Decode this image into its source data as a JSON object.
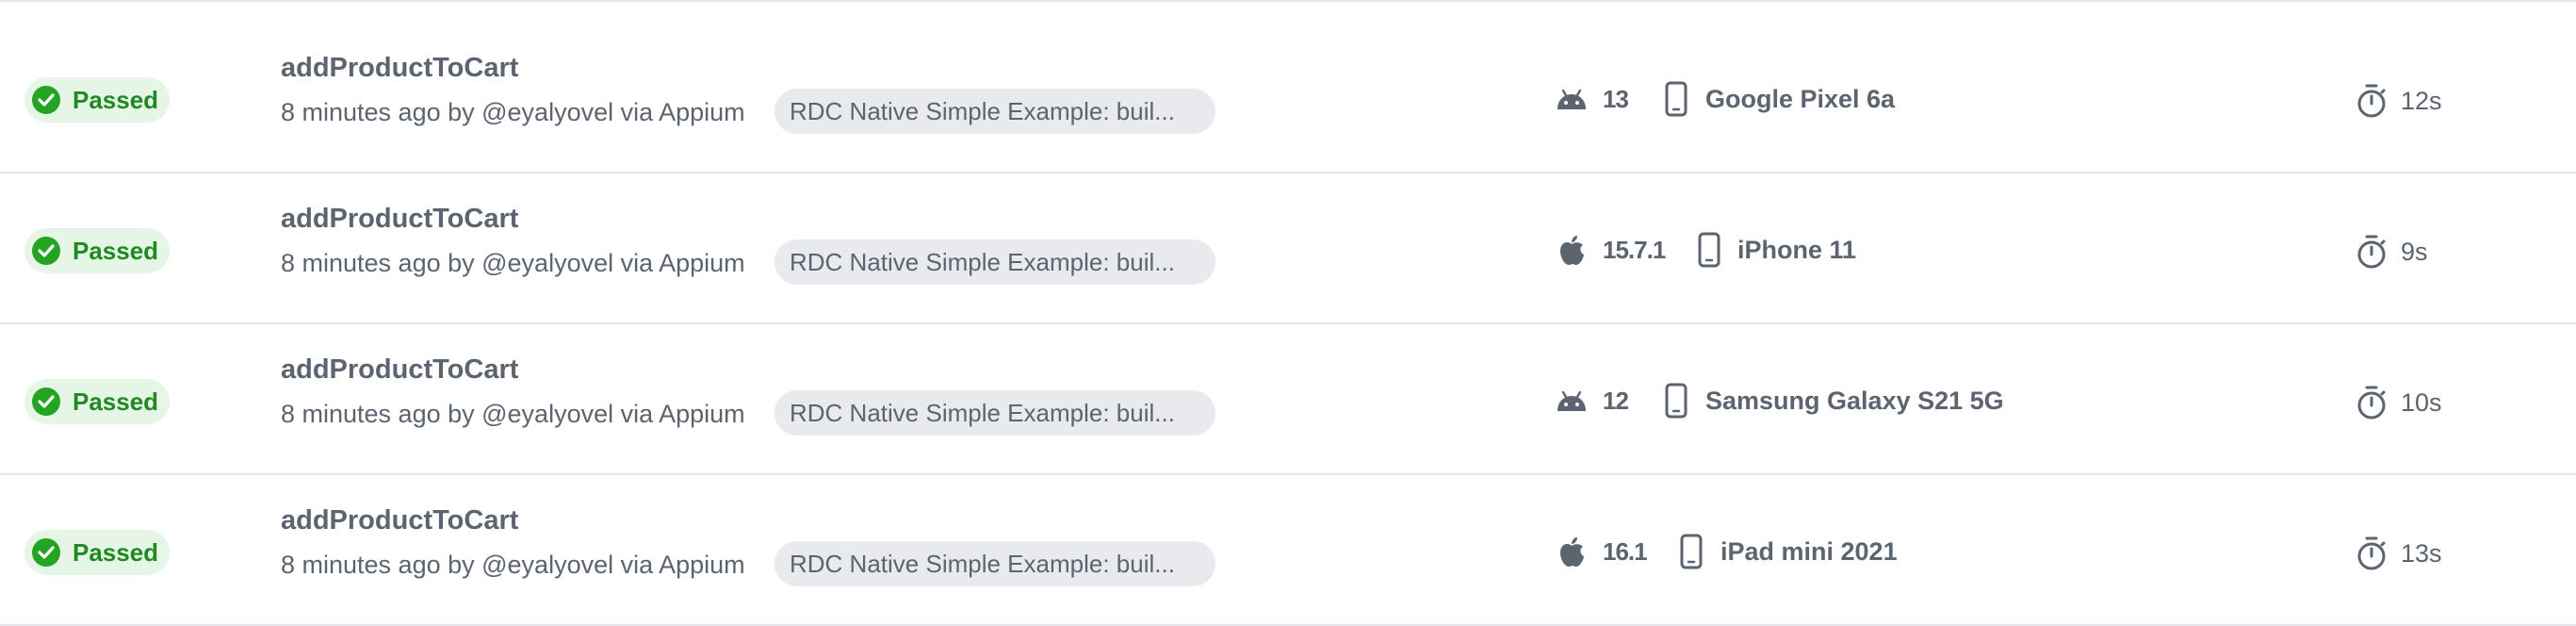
{
  "colors": {
    "passed_bg": "#e6f6e6",
    "passed_text": "#1f8a21",
    "passed_check": "#23a423",
    "chip_bg": "#e8eaee",
    "text": "#5c6470",
    "divider": "#e6e8eb"
  },
  "tests": [
    {
      "status": "Passed",
      "name": "addProductToCart",
      "meta": "8 minutes ago by @eyalyovel via Appium",
      "build": "RDC Native Simple Example: buil...",
      "os_icon": "android-icon",
      "os_version": "13",
      "device_icon": "phone-icon",
      "device": "Google Pixel 6a",
      "timer_icon": "stopwatch-icon",
      "duration": "12s"
    },
    {
      "status": "Passed",
      "name": "addProductToCart",
      "meta": "8 minutes ago by @eyalyovel via Appium",
      "build": "RDC Native Simple Example: buil...",
      "os_icon": "apple-icon",
      "os_version": "15.7.1",
      "device_icon": "phone-icon",
      "device": "iPhone 11",
      "timer_icon": "stopwatch-icon",
      "duration": "9s"
    },
    {
      "status": "Passed",
      "name": "addProductToCart",
      "meta": "8 minutes ago by @eyalyovel via Appium",
      "build": "RDC Native Simple Example: buil...",
      "os_icon": "android-icon",
      "os_version": "12",
      "device_icon": "phone-icon",
      "device": "Samsung Galaxy S21 5G",
      "timer_icon": "stopwatch-icon",
      "duration": "10s"
    },
    {
      "status": "Passed",
      "name": "addProductToCart",
      "meta": "8 minutes ago by @eyalyovel via Appium",
      "build": "RDC Native Simple Example: buil...",
      "os_icon": "apple-icon",
      "os_version": "16.1",
      "device_icon": "phone-icon",
      "device": "iPad mini 2021",
      "timer_icon": "stopwatch-icon",
      "duration": "13s"
    }
  ]
}
